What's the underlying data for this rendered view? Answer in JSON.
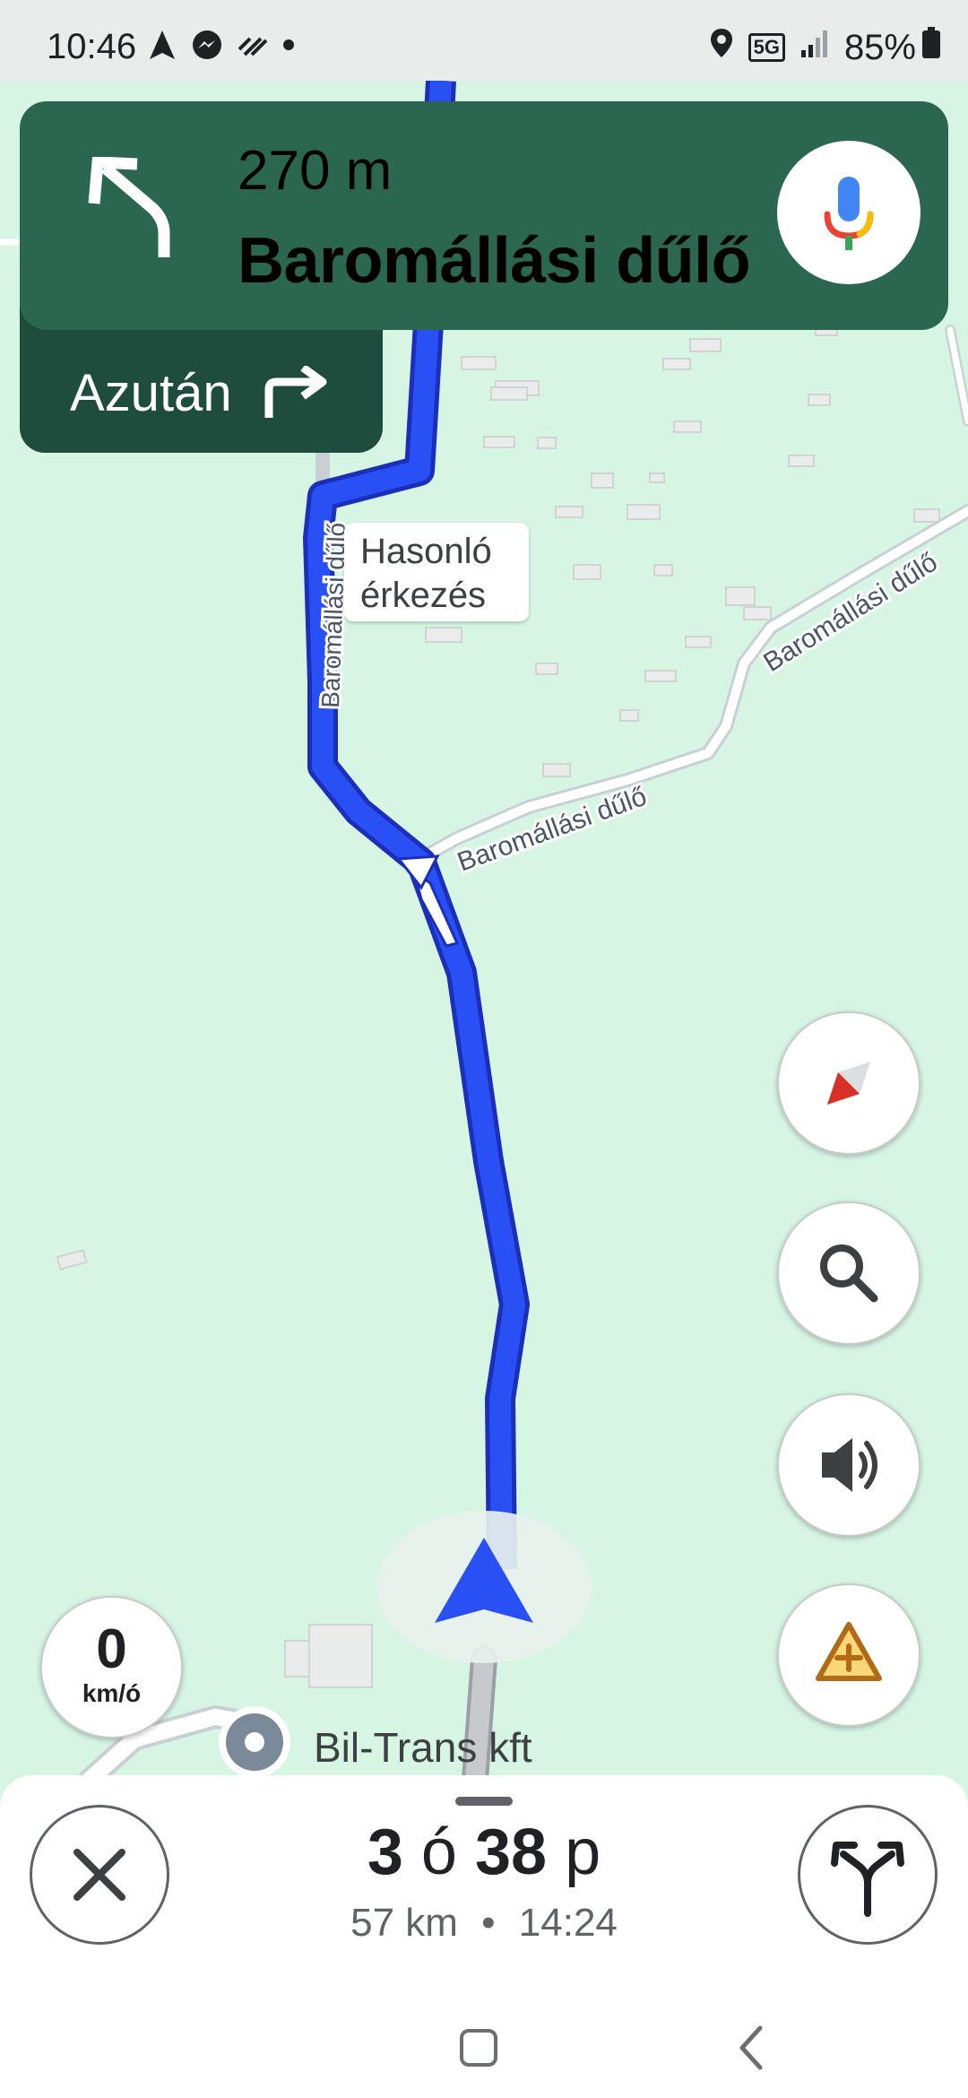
{
  "status_bar": {
    "time": "10:46",
    "network": "5G",
    "battery": "85%",
    "icons": [
      "navigation-icon",
      "messenger-icon",
      "wifi-calling-icon",
      "dot-icon",
      "location-icon",
      "signal-icon",
      "battery-icon"
    ]
  },
  "navigation": {
    "distance": "270 m",
    "street": "Baromállási dűlő",
    "maneuver_icon": "turn-slight-left-icon",
    "mic_icon": "microphone-icon",
    "then_label": "Azután",
    "then_icon": "turn-right-icon"
  },
  "map": {
    "road_labels": [
      "Baromállási dűlő",
      "Baromállási dűlő",
      "Baromállási dűlő"
    ],
    "similar_arrival": "Hasonló érkezés",
    "similar_arrival_line1": "Hasonló",
    "similar_arrival_line2": "érkezés",
    "destination": "Bil-Trans kft",
    "route_color": "#2950f5",
    "route_outline_color": "#1c2fb8",
    "map_bg_color": "#d6f5e3"
  },
  "controls": {
    "compass_icon": "compass-icon",
    "search_icon": "search-icon",
    "sound_icon": "volume-icon",
    "report_icon": "add-report-icon",
    "speed_value": "0",
    "speed_unit": "km/ó"
  },
  "bottom_sheet": {
    "hours": "3",
    "hours_unit": "ó",
    "minutes": "38",
    "minutes_unit": "p",
    "distance": "57 km",
    "separator": "•",
    "arrival_time": "14:24",
    "close_icon": "close-icon",
    "routes_icon": "alternate-routes-icon"
  },
  "system_nav": {
    "home_icon": "home-square-icon",
    "back_icon": "back-chevron-icon"
  }
}
